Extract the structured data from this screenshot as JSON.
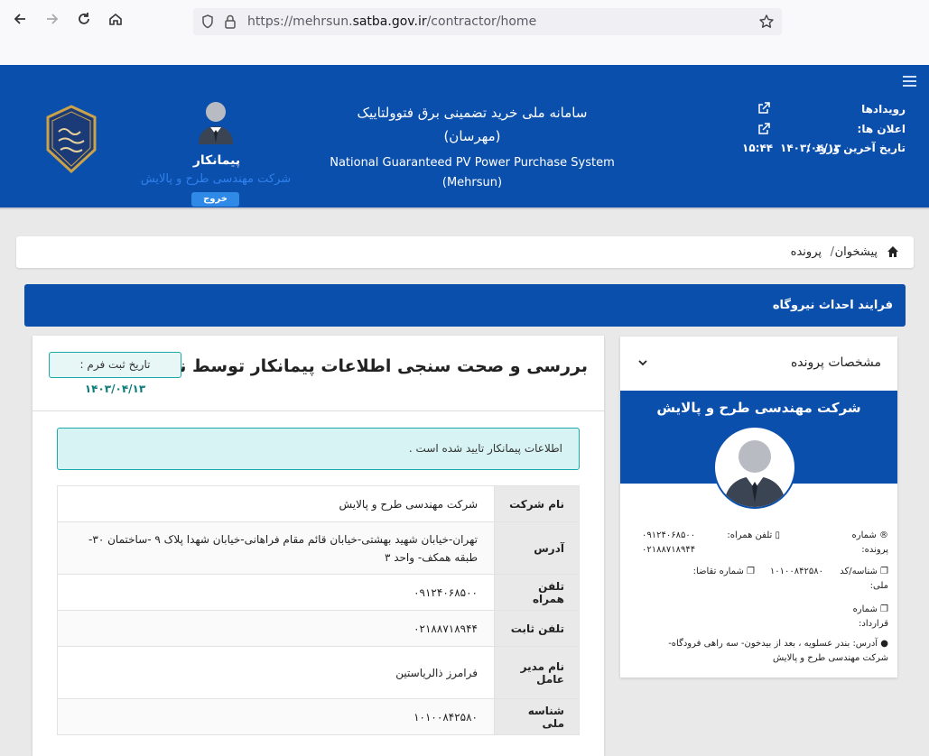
{
  "browser": {
    "url_prefix": "https://mehrsun.",
    "url_domain": "satba.gov.ir",
    "url_path": "/contractor/home"
  },
  "header": {
    "system_title_fa_line1": "سامانه ملی خرید تضمینی برق فتوولتاییک",
    "system_title_fa_line2": "(مهرسان)",
    "system_title_en_line1": "National Guaranteed PV Power Purchase System",
    "system_title_en_line2": "(Mehrsun)",
    "user_role": "پیمانکار",
    "user_company": "شرکت مهندسی طرح و پالایش",
    "logout_label": "خروج",
    "events_label": "رویدادها",
    "announcements_label": "اعلان ها:",
    "last_login_label": "تاریخ آخرین ورود :",
    "last_login_date": "۱۴۰۳/۰۴/۱۳",
    "last_login_time": "۱۵:۴۴"
  },
  "breadcrumb": {
    "home": "پیشخوان",
    "separator": "/",
    "current": "پرونده"
  },
  "process": {
    "title": "فرایند احداث نیروگاه"
  },
  "main": {
    "title": "بررسی و صحت سنجی اطلاعات پیمانکار توسط ناظر",
    "reg_date_label": "تاریخ ثبت فرم :",
    "reg_date_value": "۱۴۰۳/۰۴/۱۳",
    "alert_text": "اطلاعات پیمانکار تایید شده است .",
    "rows": [
      {
        "label": "نام شرکت",
        "value": "شرکت مهندسی طرح و پالایش"
      },
      {
        "label": "آدرس",
        "value": "تهران-خیابان شهید بهشتی-خیابان قائم مقام فراهانی-خیابان شهدا پلاک ۹ -ساختمان ۳۰-طبقه همکف- واحد ۳"
      },
      {
        "label": "تلفن همراه",
        "value": "۰۹۱۲۴۰۶۸۵۰۰"
      },
      {
        "label": "تلفن ثابت",
        "value": "۰۲۱۸۸۷۱۸۹۴۴"
      },
      {
        "label": "نام مدیر عامل",
        "value": "فرامرز ذالریاستین"
      },
      {
        "label": "شناسه ملی",
        "value": "۱۰۱۰۰۸۴۲۵۸۰"
      }
    ]
  },
  "side": {
    "title": "مشخصات پرونده",
    "company": "شرکت مهندسی طرح و پالایش",
    "file_number_label": "شماره پرونده:",
    "mobile_label": "تلفن همراه:",
    "mobile_value": "۰۹۱۲۴۰۶۸۵۰۰",
    "phone_value": "۰۲۱۸۸۷۱۸۹۴۴",
    "national_id_label": "شناسه/کد ملی:",
    "national_id_value": "۱۰۱۰۰۸۴۲۵۸۰",
    "request_number_label": "شماره تقاضا:",
    "contract_number_label": "شماره قرارداد:",
    "address_label": "آدرس:",
    "address_value": "بندر عسلویه ، بعد از بیدخون- سه راهی فرودگاه- شرکت مهندسی طرح و پالایش"
  }
}
